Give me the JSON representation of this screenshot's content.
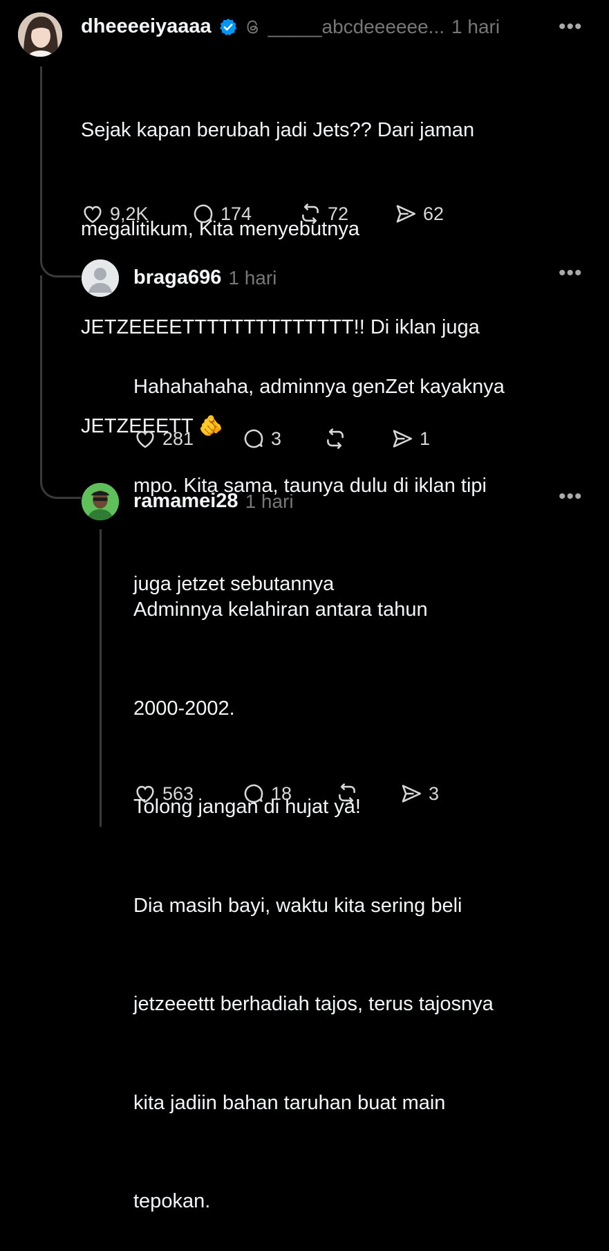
{
  "post": {
    "username": "dheeeeiyaaaa",
    "handle": "_____abcdeeeeee...",
    "time": "1 hari",
    "lines": [
      "Sejak kapan berubah jadi Jets?? Dari jaman",
      "megalitikum, Kita menyebutnya",
      "JETZEEEETTTTTTTTTTTTTT!! Di iklan juga",
      "JETZEEETT 🫵"
    ],
    "likes": "9,2K",
    "comments": "174",
    "reposts": "72",
    "shares": "62"
  },
  "reply1": {
    "username": "braga696",
    "time": "1 hari",
    "lines": [
      "Hahahahaha, adminnya genZet kayaknya",
      "mpo. Kita sama, taunya dulu di iklan tipi",
      "juga jetzet sebutannya"
    ],
    "likes": "281",
    "comments": "3",
    "reposts": "",
    "shares": "1"
  },
  "reply2": {
    "username": "ramamei28",
    "time": "1 hari",
    "lines": [
      "Adminnya kelahiran antara tahun",
      "2000-2002.",
      "Tolong jangan di hujat ya!",
      "Dia masih bayi, waktu kita sering beli",
      "jetzeeettt berhadiah tajos, terus tajosnya",
      "kita jadiin bahan taruhan buat main",
      "tepokan."
    ],
    "likes": "563",
    "comments": "18",
    "reposts": "",
    "shares": "3"
  },
  "icons": {
    "verified": "verified-badge-icon",
    "threads": "threads-logo-icon",
    "like": "heart-icon",
    "comment": "comment-bubble-icon",
    "repost": "repost-icon",
    "share": "share-send-icon",
    "more": "more-options-icon"
  },
  "colors": {
    "background": "#000000",
    "text": "#f3f5f7",
    "muted": "#777777",
    "verified": "#0095f6"
  }
}
